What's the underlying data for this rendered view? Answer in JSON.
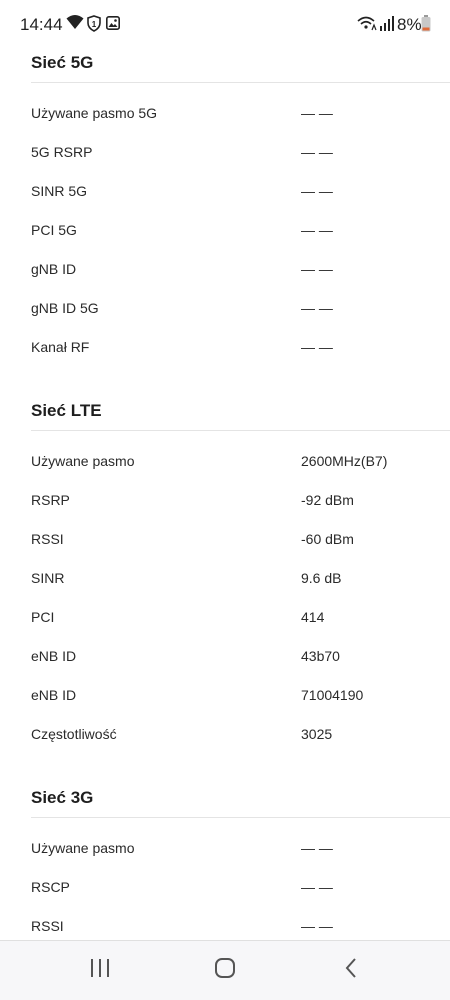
{
  "status_bar": {
    "time": "14:44",
    "battery_percent": "8%",
    "icons": [
      "wifi-icon",
      "shield-1-icon",
      "gallery-icon",
      "wifi-calling-icon",
      "signal-icon",
      "battery-low-icon"
    ]
  },
  "sections": [
    {
      "title": "Sieć 5G",
      "rows": [
        {
          "label": "Używane pasmo 5G",
          "value": "— —"
        },
        {
          "label": "5G RSRP",
          "value": "— —"
        },
        {
          "label": "SINR 5G",
          "value": "— —"
        },
        {
          "label": "PCI 5G",
          "value": "— —"
        },
        {
          "label": "gNB ID",
          "value": "— —"
        },
        {
          "label": "gNB ID 5G",
          "value": "— —"
        },
        {
          "label": "Kanał RF",
          "value": "— —"
        }
      ]
    },
    {
      "title": "Sieć LTE",
      "rows": [
        {
          "label": "Używane pasmo",
          "value": "2600MHz(B7)"
        },
        {
          "label": "RSRP",
          "value": "-92 dBm"
        },
        {
          "label": "RSSI",
          "value": "-60 dBm"
        },
        {
          "label": "SINR",
          "value": "9.6 dB"
        },
        {
          "label": "PCI",
          "value": "414"
        },
        {
          "label": "eNB ID",
          "value": "43b70"
        },
        {
          "label": "eNB ID",
          "value": "71004190"
        },
        {
          "label": "Częstotliwość",
          "value": "3025"
        }
      ]
    },
    {
      "title": "Sieć 3G",
      "rows": [
        {
          "label": "Używane pasmo",
          "value": "— —"
        },
        {
          "label": "RSCP",
          "value": "— —"
        },
        {
          "label": "RSSI",
          "value": "— —"
        }
      ]
    }
  ],
  "nav_bar": {
    "buttons": [
      "recents-icon",
      "home-icon",
      "back-icon"
    ]
  }
}
